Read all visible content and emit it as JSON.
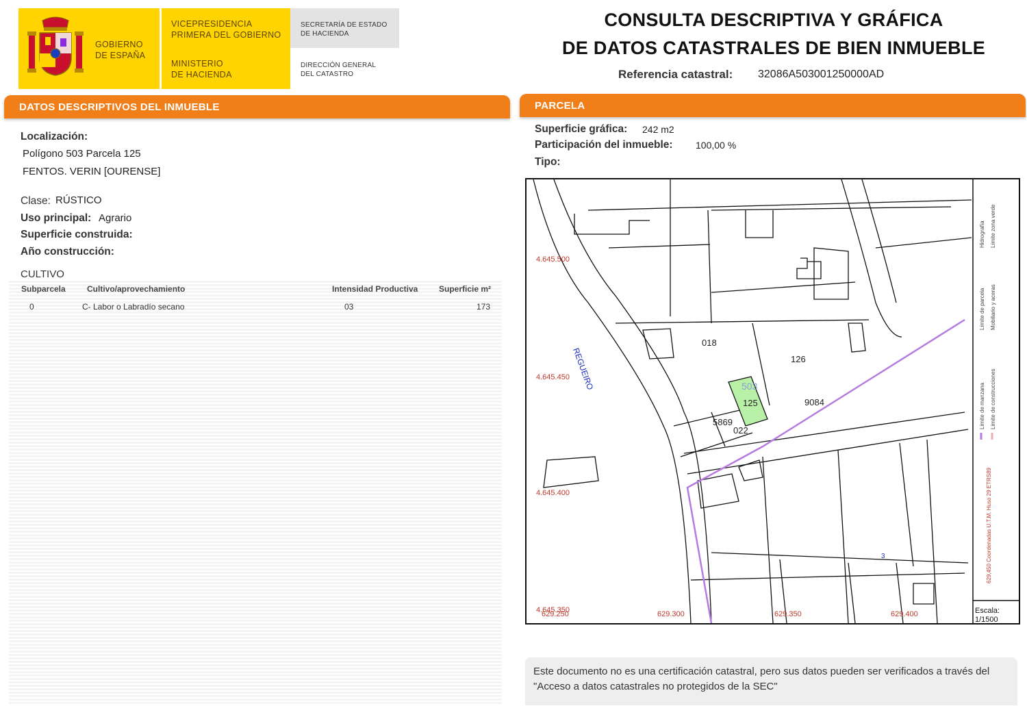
{
  "header": {
    "gobierno": [
      "GOBIERNO",
      "DE ESPAÑA"
    ],
    "vicepresidencia": [
      "VICEPRESIDENCIA",
      "PRIMERA DEL GOBIERNO"
    ],
    "ministerio": [
      "MINISTERIO",
      "DE HACIENDA"
    ],
    "secretaria": [
      "SECRETARÍA DE ESTADO",
      "DE HACIENDA"
    ],
    "direccion": [
      "DIRECCIÓN GENERAL",
      "DEL CATASTRO"
    ],
    "title_line1": "CONSULTA DESCRIPTIVA Y GRÁFICA",
    "title_line2": "DE DATOS CATASTRALES DE BIEN INMUEBLE",
    "ref_label": "Referencia catastral:",
    "ref_value": "32086A503001250000AD"
  },
  "inmueble": {
    "section_title": "DATOS DESCRIPTIVOS DEL INMUEBLE",
    "localizacion_label": "Localización:",
    "localizacion_line1": "Polígono 503 Parcela 125",
    "localizacion_line2": "FENTOS. VERIN [OURENSE]",
    "clase_label": "Clase:",
    "clase_value": "RÚSTICO",
    "uso_label": "Uso principal:",
    "uso_value": "Agrario",
    "superficie_label": "Superficie construida:",
    "anio_label": "Año construcción:"
  },
  "cultivo": {
    "title": "CULTIVO",
    "headers": [
      "Subparcela",
      "Cultivo/aprovechamiento",
      "Intensidad Productiva",
      "Superficie m²"
    ],
    "rows": [
      [
        "0",
        "C- Labor o Labradío secano",
        "03",
        "173"
      ]
    ]
  },
  "parcela": {
    "section_title": "PARCELA",
    "superficie_label": "Superficie gráfica:",
    "superficie_value": "242 m2",
    "participacion_label": "Participación del inmueble:",
    "participacion_value": "100,00 %",
    "tipo_label": "Tipo:"
  },
  "map": {
    "y_ticks": [
      "4.645.500",
      "4.645.450",
      "4.645.400",
      "4.645.350"
    ],
    "x_ticks": [
      "629.300",
      "629.350",
      "629.400"
    ],
    "x_tick_first": "629.250",
    "parcel_labels": [
      "018",
      "126",
      "503",
      "125",
      "5869",
      "9084",
      "022"
    ],
    "street_label": "REGUEIRO",
    "small_label": "3",
    "legend": [
      "Límite de manzana",
      "Límite de parcela",
      "Hidrografía",
      "Límite de construcciones",
      "Mobiliario y aceras",
      "Límite zona verde"
    ],
    "coord_note": "629,450 Coordenadas U.T.M. Huso 29 ETRS89",
    "escala_label": "Escala:",
    "escala_value": "1/1500",
    "colors": {
      "highlight": "#b8f0a8",
      "manzana": "#b57be0",
      "coord_text": "#c0392b",
      "street_text": "#1a2fbf"
    }
  },
  "notice": {
    "text": "Este documento no es una certificación catastral, pero sus datos pueden ser verificados a través del \"Acceso a datos catastrales no protegidos de la SEC\""
  }
}
